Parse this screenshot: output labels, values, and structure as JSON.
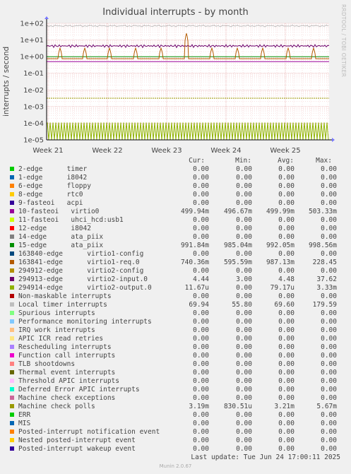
{
  "title": "Individual interrupts - by month",
  "side_label": "RRDTOOL / TOBI OETIKER",
  "footer": "Last update: Tue Jun 24 17:00:11 2025",
  "version": "Munin 2.0.67",
  "columns": {
    "cur": "Cur:",
    "min": "Min:",
    "avg": "Avg:",
    "max": "Max:"
  },
  "chart_data": {
    "type": "line",
    "ylabel": "interrupts / second",
    "yscale": "log",
    "ylim": [
      1e-05,
      100
    ],
    "yticks": [
      "1e+02",
      "1e+01",
      "1e+00",
      "1e-01",
      "1e-02",
      "1e-03",
      "1e-04",
      "1e-05"
    ],
    "xticks": [
      "Week 21",
      "Week 22",
      "Week 23",
      "Week 24",
      "Week 25"
    ],
    "series": [
      {
        "name": "2-edge      timer",
        "color": "#00cc00",
        "cur": "0.00",
        "min": "0.00",
        "avg": "0.00",
        "max": "0.00"
      },
      {
        "name": "1-edge      i8042",
        "color": "#0066b3",
        "cur": "0.00",
        "min": "0.00",
        "avg": "0.00",
        "max": "0.00"
      },
      {
        "name": "6-edge      floppy",
        "color": "#ff8000",
        "cur": "0.00",
        "min": "0.00",
        "avg": "0.00",
        "max": "0.00"
      },
      {
        "name": "8-edge      rtc0",
        "color": "#ffcc00",
        "cur": "0.00",
        "min": "0.00",
        "avg": "0.00",
        "max": "0.00"
      },
      {
        "name": "9-fasteoi   acpi",
        "color": "#330099",
        "cur": "0.00",
        "min": "0.00",
        "avg": "0.00",
        "max": "0.00"
      },
      {
        "name": "10-fasteoi   virtio0",
        "color": "#990099",
        "cur": "499.94m",
        "min": "496.67m",
        "avg": "499.99m",
        "max": "503.33m"
      },
      {
        "name": "11-fasteoi   uhci_hcd:usb1",
        "color": "#ccff00",
        "cur": "0.00",
        "min": "0.00",
        "avg": "0.00",
        "max": "0.00"
      },
      {
        "name": "12-edge      i8042",
        "color": "#ff0000",
        "cur": "0.00",
        "min": "0.00",
        "avg": "0.00",
        "max": "0.00"
      },
      {
        "name": "14-edge      ata_piix",
        "color": "#808080",
        "cur": "0.00",
        "min": "0.00",
        "avg": "0.00",
        "max": "0.00"
      },
      {
        "name": "15-edge      ata_piix",
        "color": "#008f00",
        "cur": "991.84m",
        "min": "985.04m",
        "avg": "992.05m",
        "max": "998.56m"
      },
      {
        "name": "163840-edge      virtio1-config",
        "color": "#00487d",
        "cur": "0.00",
        "min": "0.00",
        "avg": "0.00",
        "max": "0.00"
      },
      {
        "name": "163841-edge      virtio1-req.0",
        "color": "#b35a00",
        "cur": "740.36m",
        "min": "595.59m",
        "avg": "987.13m",
        "max": "228.45"
      },
      {
        "name": "294912-edge      virtio2-config",
        "color": "#b38f00",
        "cur": "0.00",
        "min": "0.00",
        "avg": "0.00",
        "max": "0.00"
      },
      {
        "name": "294913-edge      virtio2-input.0",
        "color": "#6b006b",
        "cur": "4.44",
        "min": "3.00",
        "avg": "4.48",
        "max": "37.62"
      },
      {
        "name": "294914-edge      virtio2-output.0",
        "color": "#8fb300",
        "cur": "11.67u",
        "min": "0.00",
        "avg": "79.17u",
        "max": "3.33m"
      },
      {
        "name": "Non-maskable interrupts",
        "color": "#b30000",
        "cur": "0.00",
        "min": "0.00",
        "avg": "0.00",
        "max": "0.00"
      },
      {
        "name": "Local timer interrupts",
        "color": "#bebebe",
        "cur": "69.94",
        "min": "55.80",
        "avg": "69.60",
        "max": "179.59"
      },
      {
        "name": "Spurious interrupts",
        "color": "#80ff80",
        "cur": "0.00",
        "min": "0.00",
        "avg": "0.00",
        "max": "0.00"
      },
      {
        "name": "Performance monitoring interrupts",
        "color": "#80c9ff",
        "cur": "0.00",
        "min": "0.00",
        "avg": "0.00",
        "max": "0.00"
      },
      {
        "name": "IRQ work interrupts",
        "color": "#ffc080",
        "cur": "0.00",
        "min": "0.00",
        "avg": "0.00",
        "max": "0.00"
      },
      {
        "name": "APIC ICR read retries",
        "color": "#ffe680",
        "cur": "0.00",
        "min": "0.00",
        "avg": "0.00",
        "max": "0.00"
      },
      {
        "name": "Rescheduling interrupts",
        "color": "#aa80ff",
        "cur": "0.00",
        "min": "0.00",
        "avg": "0.00",
        "max": "0.00"
      },
      {
        "name": "Function call interrupts",
        "color": "#ee00cc",
        "cur": "0.00",
        "min": "0.00",
        "avg": "0.00",
        "max": "0.00"
      },
      {
        "name": "TLB shootdowns",
        "color": "#ff8080",
        "cur": "0.00",
        "min": "0.00",
        "avg": "0.00",
        "max": "0.00"
      },
      {
        "name": "Thermal event interrupts",
        "color": "#666600",
        "cur": "0.00",
        "min": "0.00",
        "avg": "0.00",
        "max": "0.00"
      },
      {
        "name": "Threshold APIC interrupts",
        "color": "#ffbfff",
        "cur": "0.00",
        "min": "0.00",
        "avg": "0.00",
        "max": "0.00"
      },
      {
        "name": "Deferred Error APIC interrupts",
        "color": "#00ffcc",
        "cur": "0.00",
        "min": "0.00",
        "avg": "0.00",
        "max": "0.00"
      },
      {
        "name": "Machine check exceptions",
        "color": "#cc6699",
        "cur": "0.00",
        "min": "0.00",
        "avg": "0.00",
        "max": "0.00"
      },
      {
        "name": "Machine check polls",
        "color": "#999900",
        "cur": "3.19m",
        "min": "830.51u",
        "avg": "3.21m",
        "max": "5.67m"
      },
      {
        "name": "ERR",
        "color": "#00cc00",
        "cur": "0.00",
        "min": "0.00",
        "avg": "0.00",
        "max": "0.00"
      },
      {
        "name": "MIS",
        "color": "#0066b3",
        "cur": "0.00",
        "min": "0.00",
        "avg": "0.00",
        "max": "0.00"
      },
      {
        "name": "Posted-interrupt notification event",
        "color": "#ff8000",
        "cur": "0.00",
        "min": "0.00",
        "avg": "0.00",
        "max": "0.00"
      },
      {
        "name": "Nested posted-interrupt event",
        "color": "#ffcc00",
        "cur": "0.00",
        "min": "0.00",
        "avg": "0.00",
        "max": "0.00"
      },
      {
        "name": "Posted-interrupt wakeup event",
        "color": "#330099",
        "cur": "0.00",
        "min": "0.00",
        "avg": "0.00",
        "max": "0.00"
      }
    ]
  }
}
